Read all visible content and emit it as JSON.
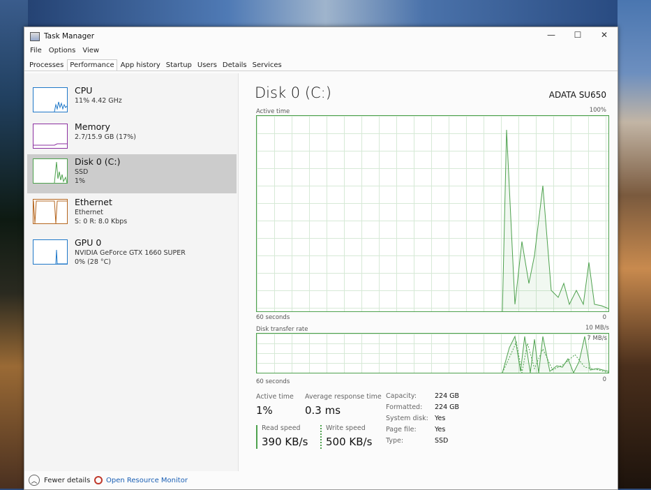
{
  "window": {
    "title": "Task Manager",
    "controls": [
      "—",
      "☐",
      "✕"
    ]
  },
  "menu": [
    "File",
    "Options",
    "View"
  ],
  "tabs": [
    "Processes",
    "Performance",
    "App history",
    "Startup",
    "Users",
    "Details",
    "Services"
  ],
  "active_tab": "Performance",
  "sidebar": {
    "items": [
      {
        "name": "CPU",
        "line1": "11% 4.42 GHz",
        "line2": "",
        "color": "#1f78c8"
      },
      {
        "name": "Memory",
        "line1": "2.7/15.9 GB (17%)",
        "line2": "",
        "color": "#8b2fa0"
      },
      {
        "name": "Disk 0 (C:)",
        "line1": "SSD",
        "line2": "1%",
        "color": "#4da14d"
      },
      {
        "name": "Ethernet",
        "line1": "Ethernet",
        "line2": "S: 0 R: 8.0 Kbps",
        "color": "#b5651d"
      },
      {
        "name": "GPU 0",
        "line1": "NVIDIA GeForce GTX 1660 SUPER",
        "line2": "0% (28 °C)",
        "color": "#1f78c8"
      }
    ],
    "selected_index": 2
  },
  "main": {
    "title": "Disk 0 (C:)",
    "device": "ADATA SU650",
    "graph1": {
      "label": "Active time",
      "max": "100%",
      "time": "60 seconds",
      "zero": "0"
    },
    "graph2": {
      "label": "Disk transfer rate",
      "max": "10 MB/s",
      "mid": "7 MB/s",
      "time": "60 seconds",
      "zero": "0"
    },
    "stats": {
      "active_time_label": "Active time",
      "active_time": "1%",
      "avg_resp_label": "Average response time",
      "avg_resp": "0.3 ms",
      "read_label": "Read speed",
      "read": "390 KB/s",
      "write_label": "Write speed",
      "write": "500 KB/s"
    },
    "properties": [
      {
        "k": "Capacity:",
        "v": "224 GB"
      },
      {
        "k": "Formatted:",
        "v": "224 GB"
      },
      {
        "k": "System disk:",
        "v": "Yes"
      },
      {
        "k": "Page file:",
        "v": "Yes"
      },
      {
        "k": "Type:",
        "v": "SSD"
      }
    ]
  },
  "footer": {
    "fewer": "Fewer details",
    "resource_monitor": "Open Resource Monitor"
  }
}
